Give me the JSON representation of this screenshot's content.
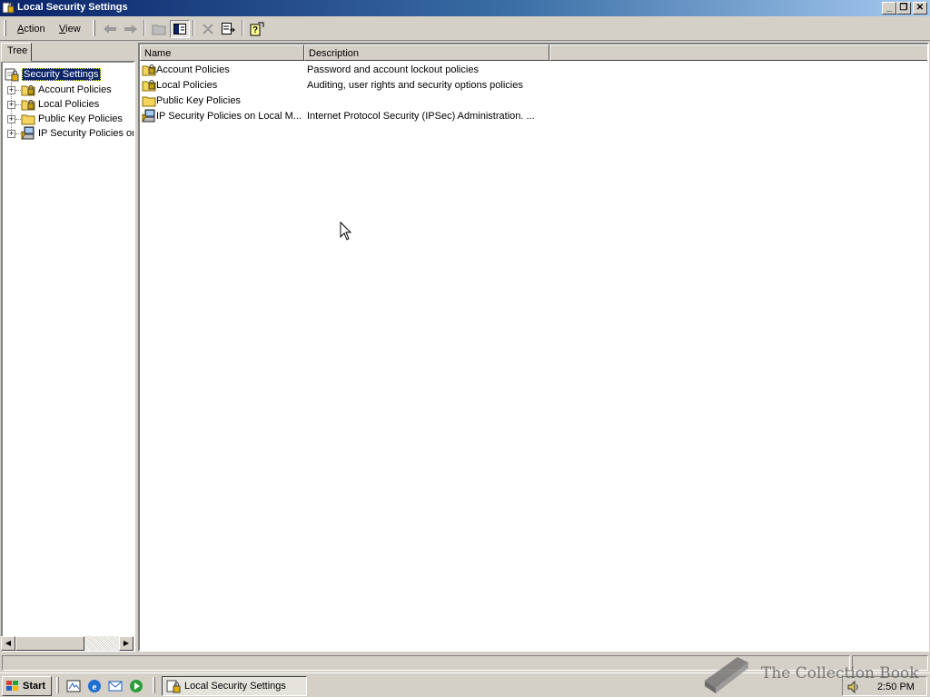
{
  "window": {
    "title": "Local Security Settings",
    "buttons": {
      "minimize": "_",
      "restore": "❐",
      "close": "✕"
    }
  },
  "menu": {
    "action": {
      "hotkey": "A",
      "rest": "ction"
    },
    "view": {
      "hotkey": "V",
      "rest": "iew"
    }
  },
  "toolbar": [
    "back-icon",
    "forward-icon",
    "up-folder-icon",
    "show-hide-tree-icon",
    "delete-icon",
    "export-list-icon",
    "help-icon"
  ],
  "tree": {
    "tab_label": "Tree",
    "root": "Security Settings",
    "items": [
      {
        "label": "Account Policies",
        "icon": "locked-folder-icon"
      },
      {
        "label": "Local Policies",
        "icon": "locked-folder-icon"
      },
      {
        "label": "Public Key Policies",
        "icon": "folder-icon"
      },
      {
        "label": "IP Security Policies on",
        "icon": "ip-security-icon"
      }
    ]
  },
  "list": {
    "columns": {
      "name": "Name",
      "description": "Description"
    },
    "rows": [
      {
        "name": "Account Policies",
        "description": "Password and account lockout policies",
        "icon": "locked-folder-icon"
      },
      {
        "name": "Local Policies",
        "description": "Auditing, user rights and security options policies",
        "icon": "locked-folder-icon"
      },
      {
        "name": "Public Key Policies",
        "description": "",
        "icon": "folder-icon"
      },
      {
        "name": "IP Security Policies on Local M...",
        "description": "Internet Protocol Security (IPSec) Administration. ...",
        "icon": "ip-security-icon"
      }
    ]
  },
  "taskbar": {
    "start_label": "Start",
    "quick_launch": [
      "show-desktop-icon",
      "internet-explorer-icon",
      "outlook-express-icon",
      "windows-media-icon"
    ],
    "task_button": "Local Security Settings",
    "clock": "2:50 PM"
  },
  "watermark": {
    "text": "The Collection Book"
  },
  "colors": {
    "title_start": "#0a246a",
    "title_end": "#a6caf0",
    "selection": "#0a246a",
    "face": "#d4d0c8"
  }
}
